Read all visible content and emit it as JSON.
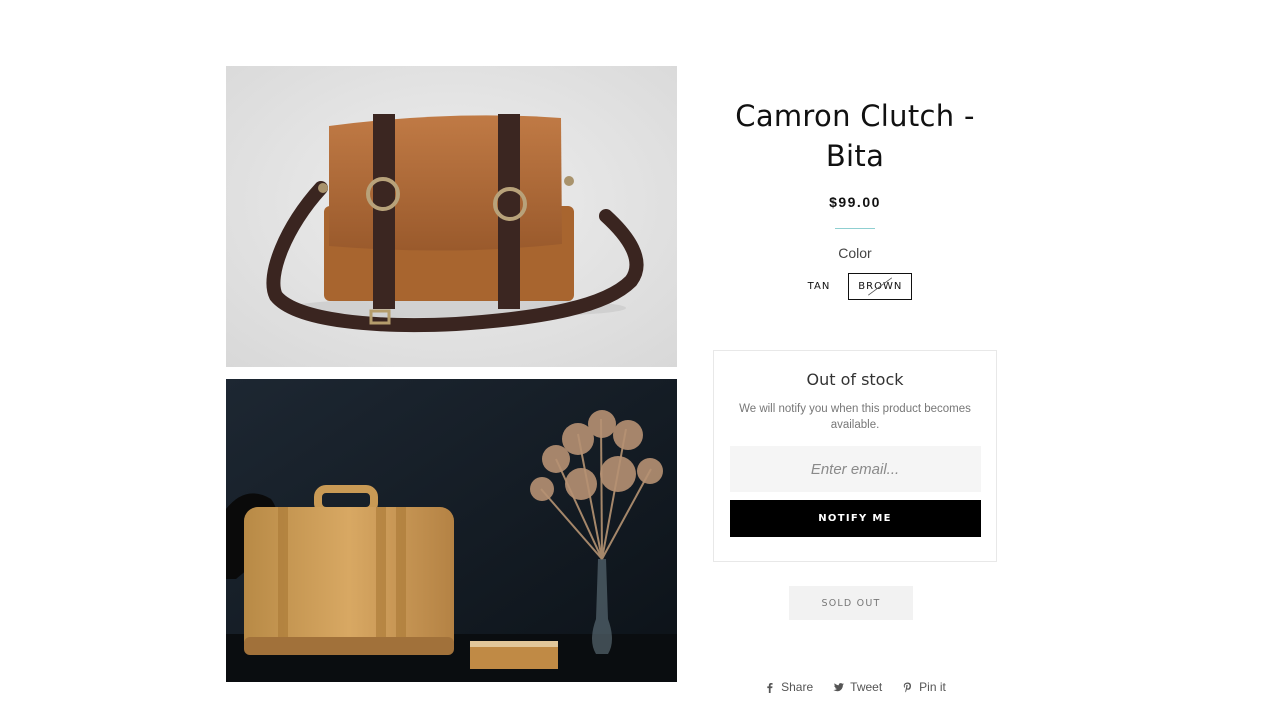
{
  "product": {
    "title": "Camron Clutch - Bita",
    "price": "$99.00",
    "option_label": "Color",
    "swatches": [
      {
        "label": "TAN",
        "selected": false,
        "unavailable": false
      },
      {
        "label": "BROWN",
        "selected": true,
        "unavailable": true
      }
    ]
  },
  "images": [
    {
      "name": "leather-messenger-bag-photo"
    },
    {
      "name": "leather-suitcase-still-life-photo"
    }
  ],
  "notify": {
    "title": "Out of stock",
    "text": "We will notify you when this product becomes available.",
    "email_placeholder": "Enter email...",
    "button_label": "NOTIFY ME"
  },
  "sold_out_label": "SOLD OUT",
  "share": {
    "facebook_label": "Share",
    "twitter_label": "Tweet",
    "pinterest_label": "Pin it"
  },
  "colors": {
    "divider": "#8fcfd1",
    "button": "#000000",
    "sold_out_bg": "#f2f2f2"
  }
}
